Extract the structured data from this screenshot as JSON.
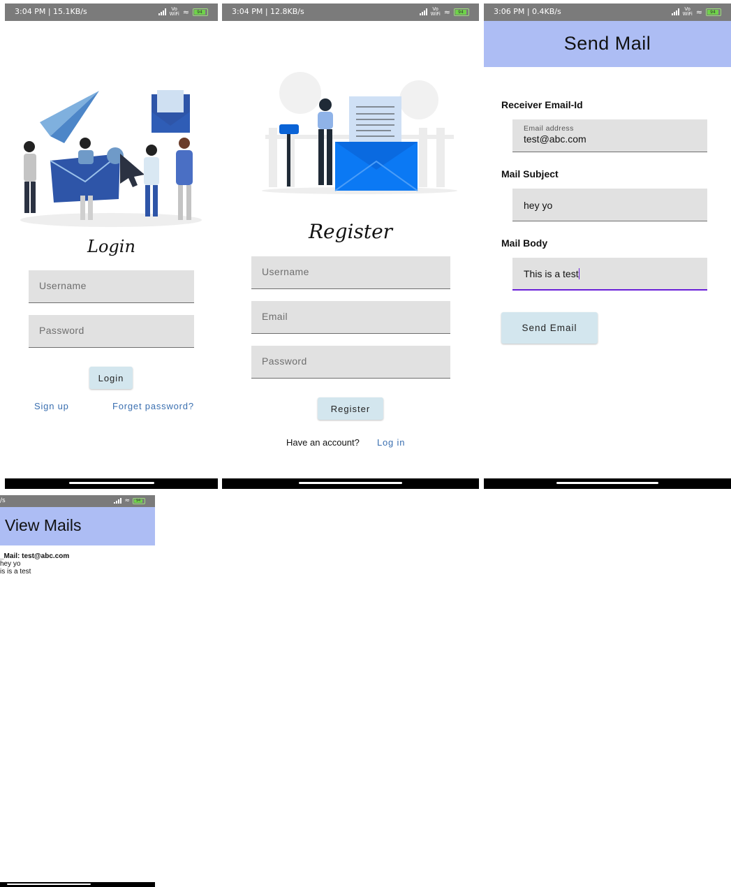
{
  "colors": {
    "status_bar": "#7b7b7b",
    "header_bg": "#adbdf4",
    "field_bg": "#e1e1e1",
    "button_bg": "#d3e6ee",
    "link": "#3a6fb0",
    "focus_underline": "#6a1fd8",
    "illustration_blue": "#2e55a8"
  },
  "screens": {
    "login": {
      "status": {
        "time_speed": "3:04 PM | 15.1KB/s",
        "battery": "94"
      },
      "title": "Login",
      "username_placeholder": "Username",
      "password_placeholder": "Password",
      "login_button": "Login",
      "signup_link": "Sign up",
      "forgot_link": "Forget password?"
    },
    "register": {
      "status": {
        "time_speed": "3:04 PM | 12.8KB/s",
        "battery": "94"
      },
      "title": "Register",
      "username_placeholder": "Username",
      "email_placeholder": "Email",
      "password_placeholder": "Password",
      "register_button": "Register",
      "have_account_text": "Have an account?",
      "login_link": "Log in"
    },
    "send_mail": {
      "status": {
        "time_speed": "3:06 PM | 0.4KB/s",
        "battery": "94"
      },
      "header_title": "Send Mail",
      "receiver_label": "Receiver Email-Id",
      "email_hint": "Email address",
      "email_value": "test@abc.com",
      "subject_label": "Mail Subject",
      "subject_value": "hey yo",
      "body_label": "Mail Body",
      "body_value": "This is a test",
      "send_button": "Send Email"
    },
    "view_mails": {
      "status": {
        "time_speed": "/s",
        "battery": "94"
      },
      "header_title": "View Mails",
      "mail_to": "_Mail: test@abc.com",
      "mail_subject": "hey yo",
      "mail_body": "is is a test"
    }
  }
}
